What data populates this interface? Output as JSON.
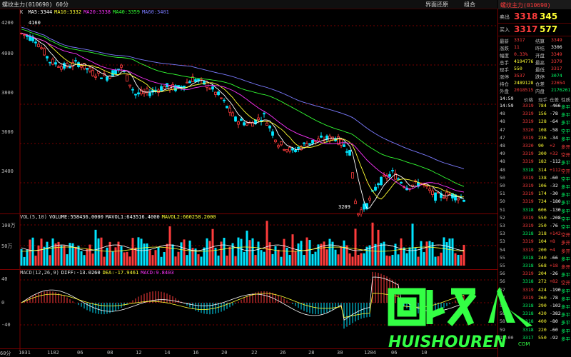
{
  "window": {
    "title": "螺纹主力(010690) 60分",
    "buttons": [
      "界面还原",
      "组合"
    ]
  },
  "main_chart": {
    "legend_prefix": "K",
    "legend": [
      {
        "text": "MA5:3344",
        "color": "#ffffff"
      },
      {
        "text": "MA10:3332",
        "color": "#ffff33"
      },
      {
        "text": "MA20:3338",
        "color": "#ff33ff"
      },
      {
        "text": "MA40:3359",
        "color": "#33ff33"
      },
      {
        "text": "MA60:3401",
        "color": "#7b7bff"
      }
    ],
    "y_ticks": [
      "4200",
      "4000",
      "3800",
      "3600",
      "3400"
    ],
    "high_label": "4160",
    "low_label": "3209"
  },
  "volume_chart": {
    "legend": [
      {
        "text": "VOL(5,10)",
        "color": "#d0d0d0"
      },
      {
        "text": "VOLUME:558436.0000",
        "color": "#ffffff"
      },
      {
        "text": "MAVOL1:643516.4000",
        "color": "#ffffff"
      },
      {
        "text": "MAVOL2:660258.2000",
        "color": "#ffff33"
      }
    ],
    "y_ticks": [
      "100万",
      "50万"
    ]
  },
  "macd_chart": {
    "legend": [
      {
        "text": "MACD(12,26,9)",
        "color": "#d0d0d0"
      },
      {
        "text": "DIFF:-13.0260",
        "color": "#ffffff"
      },
      {
        "text": "DEA:-17.9461",
        "color": "#ffff33"
      },
      {
        "text": "MACD:9.8403",
        "color": "#ff33ff"
      }
    ],
    "y_ticks": [
      "40",
      "0",
      "-40"
    ]
  },
  "x_axis": [
    "60分",
    "1031",
    "1102",
    "06",
    "08",
    "12",
    "14",
    "16",
    "20",
    "22",
    "26",
    "28",
    "30",
    "1204",
    "06",
    "10"
  ],
  "quote": {
    "name": "螺纹主力(010690)",
    "sell_label": "卖出",
    "sell_price": "3318",
    "sell_vol": "345",
    "buy_label": "买入",
    "buy_price": "3317",
    "buy_vol": "577",
    "rows": [
      [
        "最新",
        "3317",
        "结算",
        "3349"
      ],
      [
        "涨跌",
        "11",
        "昨结",
        "3306"
      ],
      [
        "幅度",
        "0.33%",
        "开盘",
        "3349"
      ],
      [
        "总手",
        "4194776",
        "最高",
        "3379"
      ],
      [
        "现手",
        "550",
        "最低",
        "3317"
      ],
      [
        "涨停",
        "3537",
        "跌停",
        "3074"
      ],
      [
        "持仓",
        "2489128",
        "仓差",
        "22654"
      ],
      [
        "外盘",
        "2018515",
        "内盘",
        "2176261"
      ]
    ]
  },
  "ticks": {
    "header": [
      "14:59",
      "价格",
      "现手",
      "仓差",
      "性质"
    ],
    "rows": [
      [
        "14:59",
        "3319",
        "784",
        "-466",
        "多平"
      ],
      [
        "48",
        "3319",
        "156",
        "-78",
        "多平"
      ],
      [
        "48",
        "3319",
        "128",
        "-64",
        "多平"
      ],
      [
        "47",
        "3320",
        "108",
        "-58",
        "空平"
      ],
      [
        "47",
        "3319",
        "236",
        "-34",
        "多平"
      ],
      [
        "48",
        "3320",
        "90",
        "+2",
        "多开"
      ],
      [
        "49",
        "3319",
        "300",
        "+32",
        "空开"
      ],
      [
        "48",
        "3319",
        "182",
        "-112",
        "多平"
      ],
      [
        "48",
        "3318",
        "314",
        "+112",
        "空开"
      ],
      [
        "50",
        "3319",
        "138",
        "-60",
        "空平"
      ],
      [
        "50",
        "3319",
        "106",
        "-32",
        "多平"
      ],
      [
        "51",
        "3319",
        "174",
        "-30",
        "多平"
      ],
      [
        "50",
        "3319",
        "734",
        "-180",
        "多平"
      ],
      [
        "51",
        "3318",
        "606",
        "-130",
        "多平"
      ],
      [
        "52",
        "3319",
        "550",
        "-208",
        "空平"
      ],
      [
        "53",
        "3319",
        "250",
        "-76",
        "空平"
      ],
      [
        "53",
        "3318",
        "318",
        "+142",
        "空开"
      ],
      [
        "53",
        "3319",
        "104",
        "+8",
        "多开"
      ],
      [
        "54",
        "3319",
        "200",
        "+4",
        "多开"
      ],
      [
        "55",
        "3318",
        "240",
        "-66",
        "多平"
      ],
      [
        "55",
        "3318",
        "568",
        "+18",
        "多开"
      ],
      [
        "56",
        "3319",
        "204",
        "-26",
        "多平"
      ],
      [
        "56",
        "3318",
        "272",
        "+82",
        "空开"
      ],
      [
        "57",
        "3319",
        "424",
        "-190",
        "多平"
      ],
      [
        "57",
        "3319",
        "260",
        "-78",
        "多平"
      ],
      [
        "58",
        "3318",
        "290",
        "-102",
        "多平"
      ],
      [
        "58",
        "3318",
        "430",
        "-382",
        "多平"
      ],
      [
        "58",
        "3318",
        "400",
        "-80",
        "多平"
      ],
      [
        "59",
        "3318",
        "220",
        "-60",
        "多平"
      ],
      [
        "15:00",
        "3317",
        "550",
        "-92",
        "多平"
      ]
    ]
  },
  "watermark": {
    "glyph_text": "回收",
    "brand": "HUISHOUREN",
    "suffix": "COM"
  },
  "colors": {
    "up": "#ff3c3c",
    "down": "#00e5ff",
    "grid": "#7a0000",
    "watermark": "#33ff44"
  }
}
